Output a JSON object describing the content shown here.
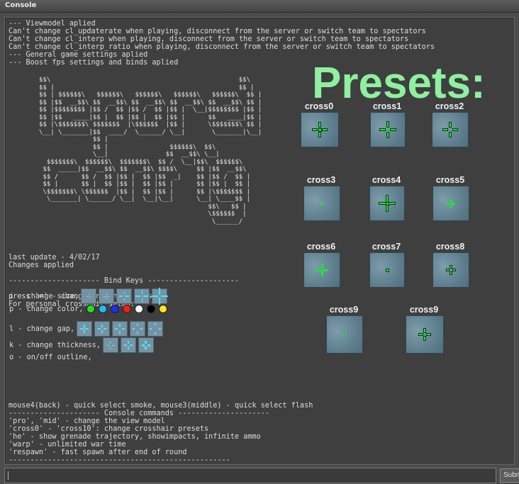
{
  "window": {
    "title": "Console"
  },
  "log": {
    "header_lines": [
      "--- Viewmodel aplied",
      "Can't change cl_updaterate when playing, disconnect from the server or switch team to spectators",
      "Can't change cl_interp when playing, disconnect from the server or switch team to spectators",
      "Can't change cl_interp_ratio when playing, disconnect from the server or switch team to spectators",
      "--- General game settings aplied",
      "--- Boost fps settings and binds aplied"
    ],
    "ascii_art": "$$\\                                                 $$\\\n$$ |                                                $$ |\n$$ | $$$$$$\\   $$$$$$\\   $$$$$$\\   $$$$$$\\   $$$$$$\\  $$ |\n$$ |$$  __$$\\ $$  __$$\\ $$  __$$\\ $$  __$$\\ $$  __$$\\ $$ |\n$$ |$$$$$$$$ |$$ /  $$ |$$ /  $$ |$$ |  \\__|$$$$$$$$ |$$ |\n$$ |$$   ____|$$ |  $$ |$$ |  $$ |$$ |      $$   ____|$$ |\n$$ |\\$$$$$$$\\ $$$$$$$  |\\$$$$$$  |$$ |      \\$$$$$$$\\ $$ |\n\\__| \\_______|$$  ____/  \\______/ \\__|       \\_______|\\__|\n              $$ |\n              $$ |                $$$$$$\\  $$\\\n              \\__|               $$  __$$\\ \\__|\n  $$$$$$$\\  $$$$$$\\  $$$$$$$\\  $$ /  \\__|$$\\  $$$$$$\\\n $$  _____|$$  __$$\\ $$  __$$\\ $$$$\\     $$ |$$  __$$\\\n $$ /      $$ /  $$ |$$ |  $$ |$$  _|    $$ |$$ /  $$ |\n $$ |      $$ |  $$ |$$ |  $$ |$$ |      $$ |$$ |  $$ |\n \\$$$$$$$\\ \\$$$$$$  |$$ |  $$ |$$ |      $$ |\\$$$$$$$ |\n  \\_______| \\______/ \\__|  \\__|\\__|      \\__| \\____$$ |\n                                            $$\\   $$ |\n                                            \\$$$$$$  |\n                                             \\______/",
    "mid_lines": [
      "last update - 4/02/17",
      "Changes applied",
      "",
      "--------------------- Bind Keys ---------------------",
      "",
      "press '=' - change crosshair presets",
      "For personal crosshair setup:"
    ],
    "key_rows": [
      {
        "label": " i - change size,",
        "kind": "size"
      },
      {
        "label": " p - change color,",
        "kind": "color"
      },
      {
        "label": " l - change gap,",
        "kind": "gap"
      },
      {
        "label": " k - change thickness,",
        "kind": "thickness"
      },
      {
        "label": " o - on/off outline,",
        "kind": "none"
      }
    ],
    "color_dots": [
      "#1fe21f",
      "#2ab8ff",
      "#1a2cff",
      "#ff1a1a",
      "#ffffff",
      "#000000",
      "#ffe51a"
    ],
    "bottom_lines": [
      "mouse4(back) - quick select smoke, mouse3(middle) - quick select flash",
      "--------------------- Console commands ---------------------",
      "'pro', 'mid' - change the view model",
      "'cross0' - 'cross10': change crosshair presets",
      "'he' - show grenade trajectory, showimpacts, infinite ammo",
      "'warp' - unlimited war time",
      "'respawn' - fast spawn after end of round",
      "---------------------------------------------------"
    ]
  },
  "presets": {
    "title": "Presets:",
    "items": [
      {
        "label": "cross0",
        "color": "#27e03e"
      },
      {
        "label": "cross1",
        "color": "#27e03e"
      },
      {
        "label": "cross2",
        "color": "#27e03e"
      },
      {
        "label": "cross3",
        "color": "#27e03e"
      },
      {
        "label": "cross4",
        "color": "#27e03e"
      },
      {
        "label": "cross5",
        "color": "#27e03e"
      },
      {
        "label": "cross6",
        "color": "#27e03e"
      },
      {
        "label": "cross7",
        "color": "#27e03e"
      },
      {
        "label": "cross8",
        "color": "#27e03e"
      },
      {
        "label": "cross9",
        "color": "#27e03e"
      },
      {
        "label": "cross9",
        "color": "#27e03e"
      }
    ]
  },
  "command_input": {
    "value": ""
  },
  "submit_button": {
    "label": "Submit"
  }
}
